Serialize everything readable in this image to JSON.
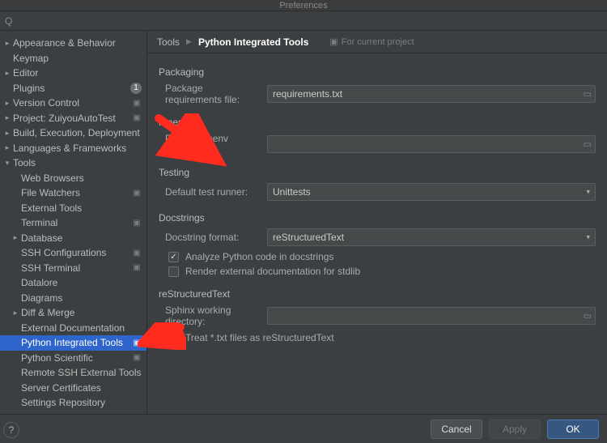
{
  "window": {
    "title": "Preferences"
  },
  "search": {
    "placeholder": "Q"
  },
  "breadcrumb": {
    "root": "Tools",
    "current": "Python Integrated Tools",
    "project_scope": "For current project"
  },
  "sidebar": {
    "items": [
      {
        "label": "Appearance & Behavior",
        "depth": 0,
        "expandable": true,
        "expanded": false
      },
      {
        "label": "Keymap",
        "depth": 0,
        "expandable": false
      },
      {
        "label": "Editor",
        "depth": 0,
        "expandable": true,
        "expanded": false
      },
      {
        "label": "Plugins",
        "depth": 0,
        "expandable": false,
        "badge": "1"
      },
      {
        "label": "Version Control",
        "depth": 0,
        "expandable": true,
        "expanded": false,
        "project": true
      },
      {
        "label": "Project: ZuiyouAutoTest",
        "depth": 0,
        "expandable": true,
        "expanded": false,
        "project": true
      },
      {
        "label": "Build, Execution, Deployment",
        "depth": 0,
        "expandable": true,
        "expanded": false
      },
      {
        "label": "Languages & Frameworks",
        "depth": 0,
        "expandable": true,
        "expanded": false
      },
      {
        "label": "Tools",
        "depth": 0,
        "expandable": true,
        "expanded": true
      },
      {
        "label": "Web Browsers",
        "depth": 1,
        "expandable": false
      },
      {
        "label": "File Watchers",
        "depth": 1,
        "expandable": false,
        "project": true
      },
      {
        "label": "External Tools",
        "depth": 1,
        "expandable": false
      },
      {
        "label": "Terminal",
        "depth": 1,
        "expandable": false,
        "project": true
      },
      {
        "label": "Database",
        "depth": 1,
        "expandable": true,
        "expanded": false
      },
      {
        "label": "SSH Configurations",
        "depth": 1,
        "expandable": false,
        "project": true
      },
      {
        "label": "SSH Terminal",
        "depth": 1,
        "expandable": false,
        "project": true
      },
      {
        "label": "Datalore",
        "depth": 1,
        "expandable": false
      },
      {
        "label": "Diagrams",
        "depth": 1,
        "expandable": false
      },
      {
        "label": "Diff & Merge",
        "depth": 1,
        "expandable": true,
        "expanded": false
      },
      {
        "label": "External Documentation",
        "depth": 1,
        "expandable": false
      },
      {
        "label": "Python Integrated Tools",
        "depth": 1,
        "expandable": false,
        "project": true,
        "selected": true
      },
      {
        "label": "Python Scientific",
        "depth": 1,
        "expandable": false,
        "project": true
      },
      {
        "label": "Remote SSH External Tools",
        "depth": 1,
        "expandable": false
      },
      {
        "label": "Server Certificates",
        "depth": 1,
        "expandable": false
      },
      {
        "label": "Settings Repository",
        "depth": 1,
        "expandable": false
      }
    ]
  },
  "sections": {
    "packaging": {
      "title": "Packaging",
      "req_label": "Package requirements file:",
      "req_value": "requirements.txt"
    },
    "pipenv": {
      "title": "Pipenv",
      "exe_label": "Path to Pipenv executable:",
      "exe_value": ""
    },
    "testing": {
      "title": "Testing",
      "runner_label": "Default test runner:",
      "runner_value": "Unittests"
    },
    "docstrings": {
      "title": "Docstrings",
      "format_label": "Docstring format:",
      "format_value": "reStructuredText",
      "analyze_label": "Analyze Python code in docstrings",
      "analyze_checked": true,
      "render_label": "Render external documentation for stdlib",
      "render_checked": false
    },
    "rst": {
      "title": "reStructuredText",
      "sphinx_label": "Sphinx working directory:",
      "sphinx_value": "",
      "treat_label": "Treat *.txt files as reStructuredText",
      "treat_checked": false
    }
  },
  "footer": {
    "cancel": "Cancel",
    "apply": "Apply",
    "ok": "OK"
  }
}
